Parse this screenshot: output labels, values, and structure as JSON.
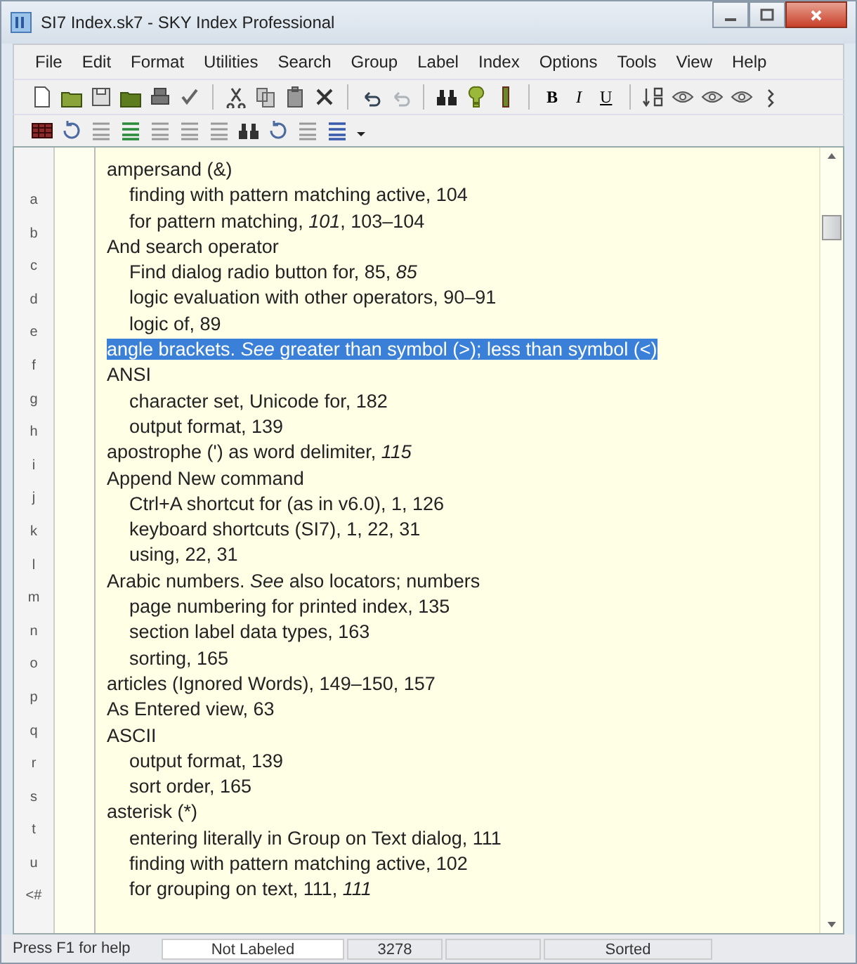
{
  "window": {
    "title": "SI7 Index.sk7 - SKY Index Professional"
  },
  "menu": [
    "File",
    "Edit",
    "Format",
    "Utilities",
    "Search",
    "Group",
    "Label",
    "Index",
    "Options",
    "Tools",
    "View",
    "Help"
  ],
  "toolbar1": [
    {
      "kind": "new"
    },
    {
      "kind": "open"
    },
    {
      "kind": "save"
    },
    {
      "kind": "folder"
    },
    {
      "kind": "print"
    },
    {
      "kind": "spell"
    },
    {
      "kind": "sep"
    },
    {
      "kind": "cut"
    },
    {
      "kind": "copy"
    },
    {
      "kind": "paste"
    },
    {
      "kind": "delete"
    },
    {
      "kind": "sep"
    },
    {
      "kind": "undo"
    },
    {
      "kind": "redo",
      "disabled": true
    },
    {
      "kind": "sep"
    },
    {
      "kind": "find"
    },
    {
      "kind": "bulb"
    },
    {
      "kind": "marker"
    },
    {
      "kind": "sep"
    },
    {
      "kind": "bold",
      "label": "B"
    },
    {
      "kind": "italic",
      "label": "I"
    },
    {
      "kind": "underline",
      "label": "U"
    },
    {
      "kind": "sep"
    },
    {
      "kind": "sort"
    },
    {
      "kind": "eye"
    },
    {
      "kind": "eye"
    },
    {
      "kind": "eye"
    },
    {
      "kind": "more"
    }
  ],
  "toolbar2": [
    {
      "kind": "grid"
    },
    {
      "kind": "refresh"
    },
    {
      "kind": "lines"
    },
    {
      "kind": "lines-green"
    },
    {
      "kind": "lines"
    },
    {
      "kind": "lines"
    },
    {
      "kind": "lines"
    },
    {
      "kind": "binoculars"
    },
    {
      "kind": "refresh"
    },
    {
      "kind": "lines"
    },
    {
      "kind": "lines-blue"
    },
    {
      "kind": "dropdown"
    }
  ],
  "letters": [
    "a",
    "b",
    "c",
    "d",
    "e",
    "f",
    "g",
    "h",
    "i",
    "j",
    "k",
    "l",
    "m",
    "n",
    "o",
    "p",
    "q",
    "r",
    "s",
    "t",
    "u",
    "<#"
  ],
  "entries": [
    {
      "text": "ampersand (&)",
      "selected": false,
      "children": [
        {
          "text": "finding with pattern matching active, 104",
          "selected": false
        },
        {
          "text": "for pattern matching, *101*, 103–104",
          "selected": false
        }
      ]
    },
    {
      "text": "And search operator",
      "selected": false,
      "children": [
        {
          "text": "Find dialog radio button for, 85, *85*",
          "selected": false
        },
        {
          "text": "logic evaluation with other operators, 90–91",
          "selected": false
        },
        {
          "text": "logic of, 89",
          "selected": false
        }
      ]
    },
    {
      "text": "angle brackets. *See* greater than symbol (>); less than symbol (<)",
      "selected": true
    },
    {
      "text": "ANSI",
      "selected": false,
      "children": [
        {
          "text": "character set, Unicode for, 182",
          "selected": false
        },
        {
          "text": "output format, 139",
          "selected": false
        }
      ]
    },
    {
      "text": "apostrophe (') as word delimiter, *115*",
      "selected": false
    },
    {
      "text": "Append New command",
      "selected": false,
      "children": [
        {
          "text": "Ctrl+A shortcut for (as in v6.0), 1, 126",
          "selected": false
        },
        {
          "text": "keyboard shortcuts (SI7), 1, 22, 31",
          "selected": false
        },
        {
          "text": "using, 22, 31",
          "selected": false
        }
      ]
    },
    {
      "text": "Arabic numbers. *See* also locators; numbers",
      "selected": false,
      "children": [
        {
          "text": "page numbering for printed index, 135",
          "selected": false
        },
        {
          "text": "section label data types, 163",
          "selected": false
        },
        {
          "text": "sorting, 165",
          "selected": false
        }
      ]
    },
    {
      "text": "articles (Ignored Words), 149–150, 157",
      "selected": false
    },
    {
      "text": "As Entered view, 63",
      "selected": false
    },
    {
      "text": "ASCII",
      "selected": false,
      "children": [
        {
          "text": "output format, 139",
          "selected": false
        },
        {
          "text": "sort order, 165",
          "selected": false
        }
      ]
    },
    {
      "text": "asterisk (*)",
      "selected": false,
      "children": [
        {
          "text": "entering literally in Group on Text dialog, 111",
          "selected": false
        },
        {
          "text": "finding with pattern matching active, 102",
          "selected": false
        },
        {
          "text": "for grouping on text, 111, *111*",
          "selected": false
        }
      ]
    }
  ],
  "status_bar": [
    "Press F1 for help",
    "Not Labeled",
    "3278",
    "Sorted"
  ]
}
